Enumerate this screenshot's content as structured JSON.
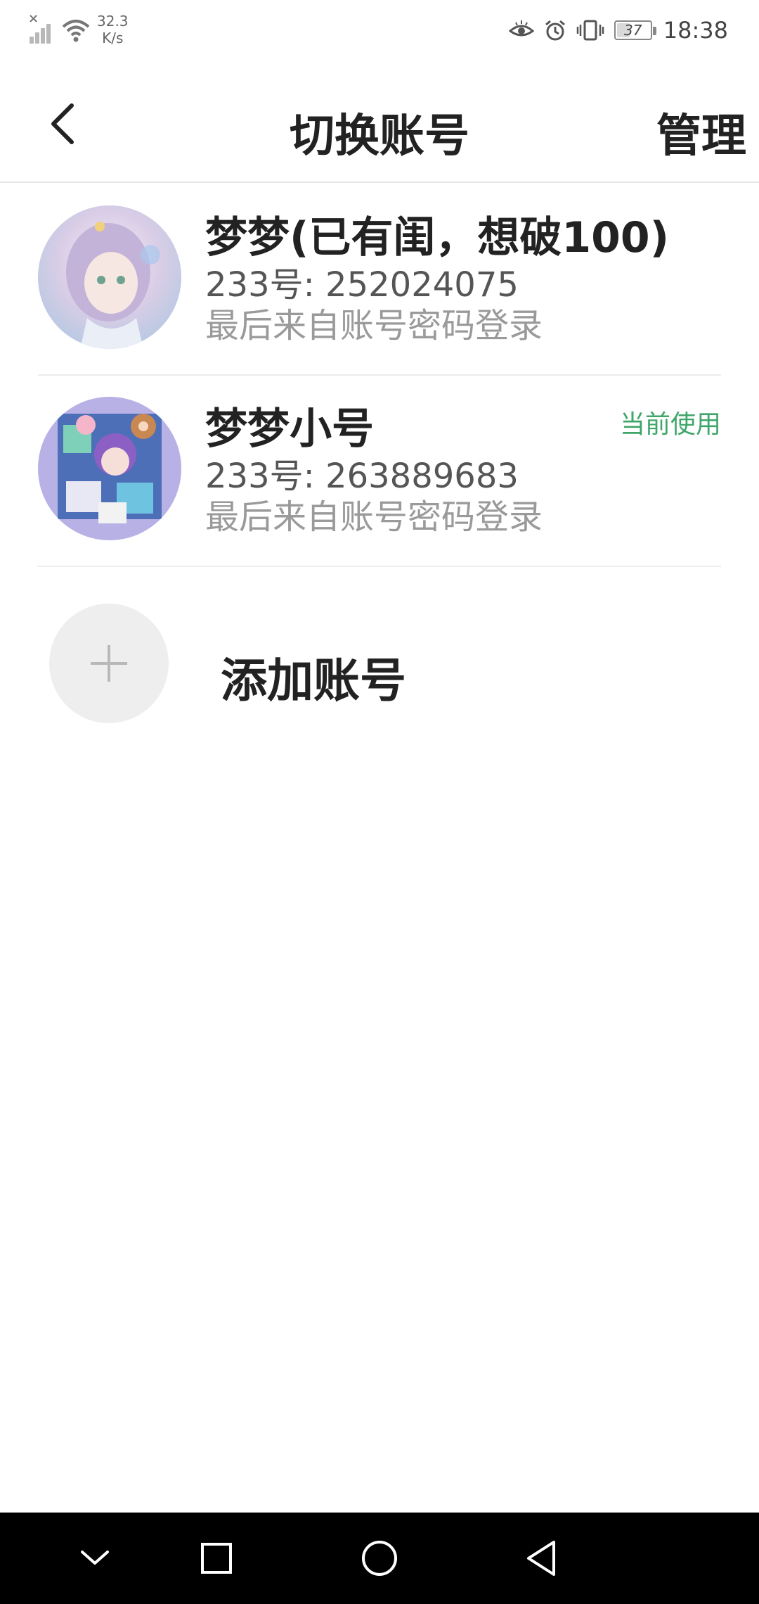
{
  "status_bar": {
    "network_speed_value": "32.3",
    "network_speed_unit": "K/s",
    "battery_level": "37",
    "time": "18:38",
    "icons": [
      "signal-no-sim-icon",
      "wifi-icon",
      "eye-comfort-icon",
      "alarm-icon",
      "vibrate-icon",
      "battery-icon"
    ]
  },
  "header": {
    "title": "切换账号",
    "manage_label": "管理",
    "back_icon": "back-arrow-icon"
  },
  "accounts": [
    {
      "name": "梦梦(已有闺，想破100)",
      "id_text": "233号: 252024075",
      "login_text": "最后来自账号密码登录",
      "badge": ""
    },
    {
      "name": "梦梦小号",
      "id_text": "233号: 263889683",
      "login_text": "最后来自账号密码登录",
      "badge": "当前使用"
    }
  ],
  "add_account": {
    "label": "添加账号",
    "icon": "plus-icon"
  },
  "colors": {
    "accent_green": "#3fa66a",
    "text_primary": "#222222",
    "text_secondary": "#9a9a9a",
    "nav_bar": "#000000"
  },
  "nav_bar": {
    "icons": [
      "hide-nav-icon",
      "recents-icon",
      "home-icon",
      "back-icon"
    ]
  }
}
